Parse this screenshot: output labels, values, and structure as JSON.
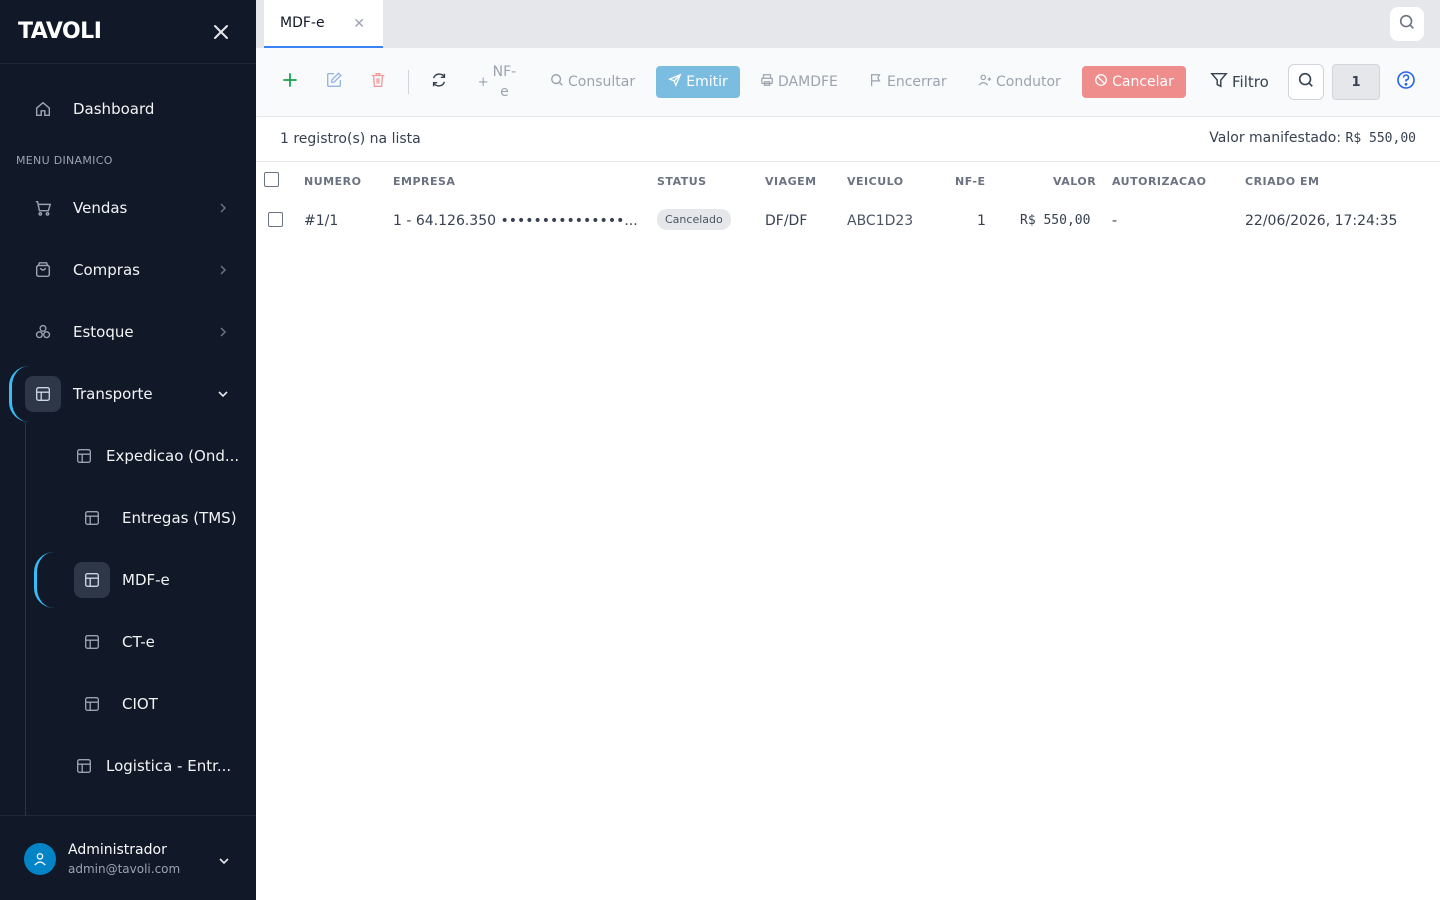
{
  "app": {
    "logo": "TAVOLI"
  },
  "sidebar": {
    "dashboard": "Dashboard",
    "section_label": "MENU DINAMICO",
    "items": [
      {
        "label": "Vendas",
        "icon": "cart-icon"
      },
      {
        "label": "Compras",
        "icon": "bag-icon"
      },
      {
        "label": "Estoque",
        "icon": "boxes-icon"
      },
      {
        "label": "Transporte",
        "icon": "layout-icon"
      }
    ],
    "sub_items": [
      {
        "label": "Expedicao (Ond..."
      },
      {
        "label": "Entregas (TMS)"
      },
      {
        "label": "MDF-e"
      },
      {
        "label": "CT-e"
      },
      {
        "label": "CIOT"
      },
      {
        "label": "Logistica - Entr..."
      }
    ],
    "user": {
      "name": "Administrador",
      "email": "admin@tavoli.com"
    }
  },
  "tabs": [
    {
      "label": "MDF-e"
    }
  ],
  "toolbar": {
    "nfe_label_1": "NF-",
    "nfe_label_2": "e",
    "consultar": "Consultar",
    "emitir": "Emitir",
    "damdfe": "DAMDFE",
    "encerrar": "Encerrar",
    "condutor": "Condutor",
    "cancelar": "Cancelar",
    "filtro": "Filtro",
    "page": "1"
  },
  "summary": {
    "count": "1 registro(s) na lista",
    "manifest_label": "Valor manifestado:",
    "manifest_value": "R$ 550,00"
  },
  "table": {
    "columns": [
      "NUMERO",
      "EMPRESA",
      "STATUS",
      "VIAGEM",
      "VEICULO",
      "NF-E",
      "VALOR",
      "AUTORIZACAO",
      "CRIADO EM"
    ],
    "rows": [
      {
        "numero": "#1/1",
        "empresa": "1 - 64.126.350 •••••••••••••••...",
        "status": "Cancelado",
        "viagem": "DF/DF",
        "veiculo": "ABC1D23",
        "nfe": "1",
        "valor": "R$ 550,00",
        "autorizacao": "-",
        "criado_em": "22/06/2026, 17:24:35"
      }
    ]
  },
  "colors": {
    "sidebar_bg": "#111827",
    "accent": "#38bdf8",
    "emitir": "#7bbde0",
    "cancelar": "#ef8c8c",
    "add_green": "#16a34a",
    "delete_red": "#ef4444"
  }
}
